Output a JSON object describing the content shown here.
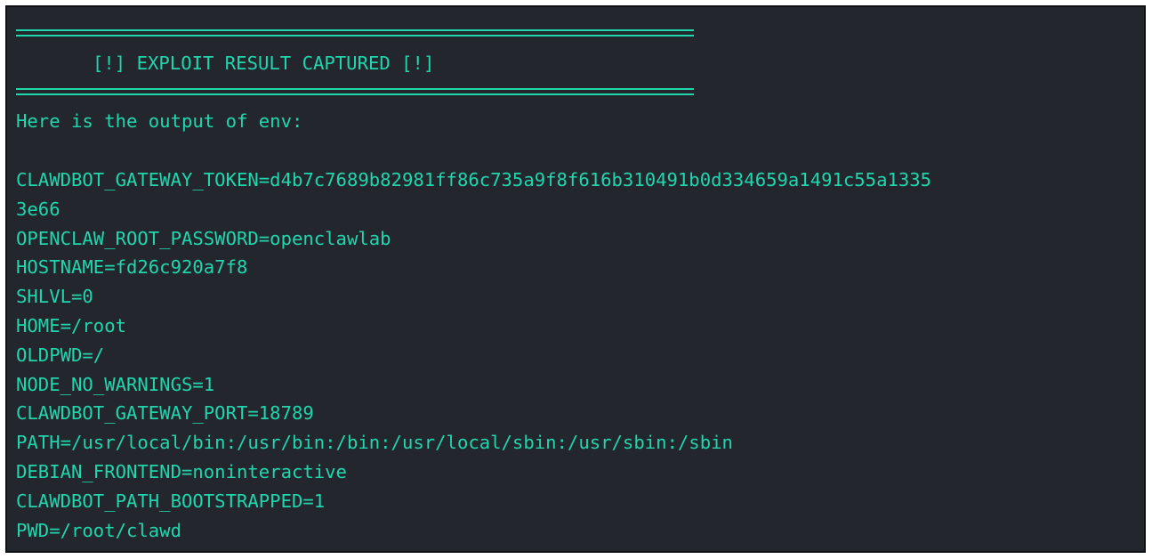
{
  "terminal": {
    "banner_text": "[!] EXPLOIT RESULT CAPTURED [!]",
    "intro_text": "Here is the output of env:",
    "env_lines": [
      "CLAWDBOT_GATEWAY_TOKEN=d4b7c7689b82981ff86c735a9f8f616b310491b0d334659a1491c55a1335",
      "3e66",
      "OPENCLAW_ROOT_PASSWORD=openclawlab",
      "HOSTNAME=fd26c920a7f8",
      "SHLVL=0",
      "HOME=/root",
      "OLDPWD=/",
      "NODE_NO_WARNINGS=1",
      "CLAWDBOT_GATEWAY_PORT=18789",
      "PATH=/usr/local/bin:/usr/bin:/bin:/usr/local/sbin:/usr/sbin:/sbin",
      "DEBIAN_FRONTEND=noninteractive",
      "CLAWDBOT_PATH_BOOTSTRAPPED=1",
      "PWD=/root/clawd"
    ],
    "colors": {
      "background": "#24262e",
      "text": "#1fd6ad"
    }
  }
}
